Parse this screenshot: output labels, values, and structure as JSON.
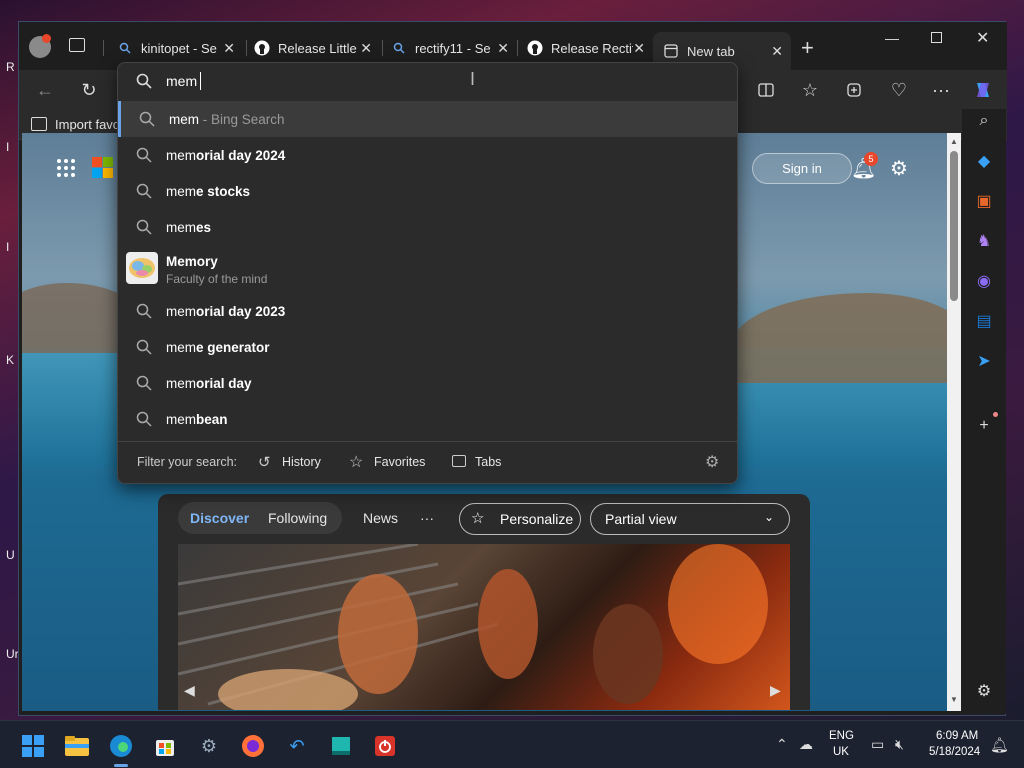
{
  "desktop": {
    "side_letters": [
      "R",
      "I",
      "I",
      "K",
      "U",
      "Ur"
    ]
  },
  "tabs": [
    {
      "label": "kinitopet - Se",
      "icon": "search-icon"
    },
    {
      "label": "Release Little",
      "icon": "github-icon"
    },
    {
      "label": "rectify11 - Se",
      "icon": "search-icon"
    },
    {
      "label": "Release Rectif",
      "icon": "github-icon"
    },
    {
      "label": "New tab",
      "icon": "newtab-icon",
      "active": true
    }
  ],
  "favbar": {
    "import_label": "Import favo"
  },
  "search": {
    "query": "mem",
    "suggestions": [
      {
        "prefix": "mem",
        "rest": "",
        "hint": " - Bing Search",
        "type": "search",
        "selected": true
      },
      {
        "prefix": "mem",
        "rest": "orial day 2024",
        "type": "search"
      },
      {
        "prefix": "mem",
        "rest": "e stocks",
        "type": "search"
      },
      {
        "prefix": "mem",
        "rest": "es",
        "type": "search"
      },
      {
        "prefix": "Mem",
        "rest": "ory",
        "sub": "Faculty of the mind",
        "type": "entity"
      },
      {
        "prefix": "mem",
        "rest": "orial day 2023",
        "type": "search"
      },
      {
        "prefix": "mem",
        "rest": "e generator",
        "type": "search"
      },
      {
        "prefix": "mem",
        "rest": "orial day",
        "type": "search"
      },
      {
        "prefix": "mem",
        "rest": "bean",
        "type": "search"
      }
    ],
    "filter_label": "Filter your search:",
    "filters": [
      "History",
      "Favorites",
      "Tabs"
    ]
  },
  "header": {
    "signin": "Sign in",
    "notif_count": "5"
  },
  "feed": {
    "tabs": [
      "Discover",
      "Following",
      "News"
    ],
    "more": "···",
    "personalize": "Personalize",
    "view": "Partial view"
  },
  "tray": {
    "lang1": "ENG",
    "lang2": "UK",
    "time": "6:09 AM",
    "date": "5/18/2024"
  },
  "colors": {
    "accent": "#6aa3e8",
    "discover": "#7fb6f5",
    "badge": "#e8472b"
  }
}
